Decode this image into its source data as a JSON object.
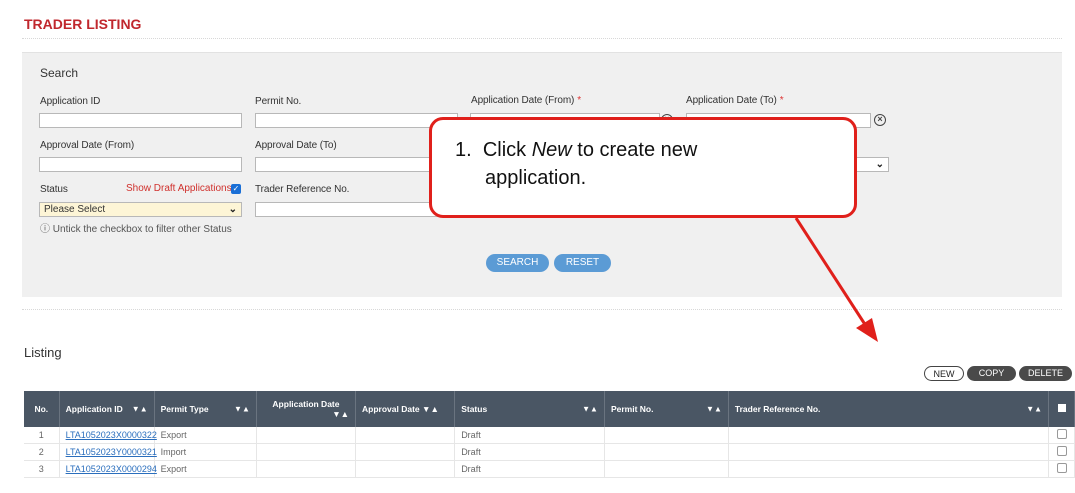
{
  "page": {
    "title": "TRADER LISTING"
  },
  "search": {
    "heading": "Search",
    "application_id_label": "Application ID",
    "permit_no_label": "Permit No.",
    "app_date_from_label": "Application Date (From)",
    "app_date_to_label": "Application Date (To)",
    "required_mark": "*",
    "approval_date_from_label": "Approval Date (From)",
    "approval_date_to_label": "Approval Date (To)",
    "status_label": "Status",
    "show_draft_label": "Show Draft Applications",
    "trader_ref_label": "Trader Reference No.",
    "status_value": "Please Select",
    "hint": "Untick the checkbox to filter other Status",
    "search_button": "SEARCH",
    "reset_button": "RESET"
  },
  "callout": {
    "number": "1.",
    "text_before": "Click ",
    "text_em": "New",
    "text_after": " to create new",
    "text_line2": "application."
  },
  "listing": {
    "heading": "Listing",
    "new_button": "NEW",
    "copy_button": "COPY",
    "delete_button": "DELETE",
    "columns": [
      "No.",
      "Application ID",
      "Permit Type",
      "Application Date",
      "Approval Date",
      "Status",
      "Permit No.",
      "Trader Reference No."
    ],
    "sort_glyph": "▼▲",
    "rows": [
      {
        "no": "1",
        "application_id": "LTA1052023X0000322",
        "permit_type": "Export",
        "application_date": "",
        "approval_date": "",
        "status": "Draft",
        "permit_no": "",
        "trader_ref": ""
      },
      {
        "no": "2",
        "application_id": "LTA1052023Y0000321",
        "permit_type": "Import",
        "application_date": "",
        "approval_date": "",
        "status": "Draft",
        "permit_no": "",
        "trader_ref": ""
      },
      {
        "no": "3",
        "application_id": "LTA1052023X0000294",
        "permit_type": "Export",
        "application_date": "",
        "approval_date": "",
        "status": "Draft",
        "permit_no": "",
        "trader_ref": ""
      }
    ]
  },
  "colors": {
    "brand_red": "#c0272d",
    "table_header": "#4a5664",
    "pill_blue": "#5b9bd5",
    "link_blue": "#2a6ebd",
    "callout_red": "#e0201b"
  }
}
